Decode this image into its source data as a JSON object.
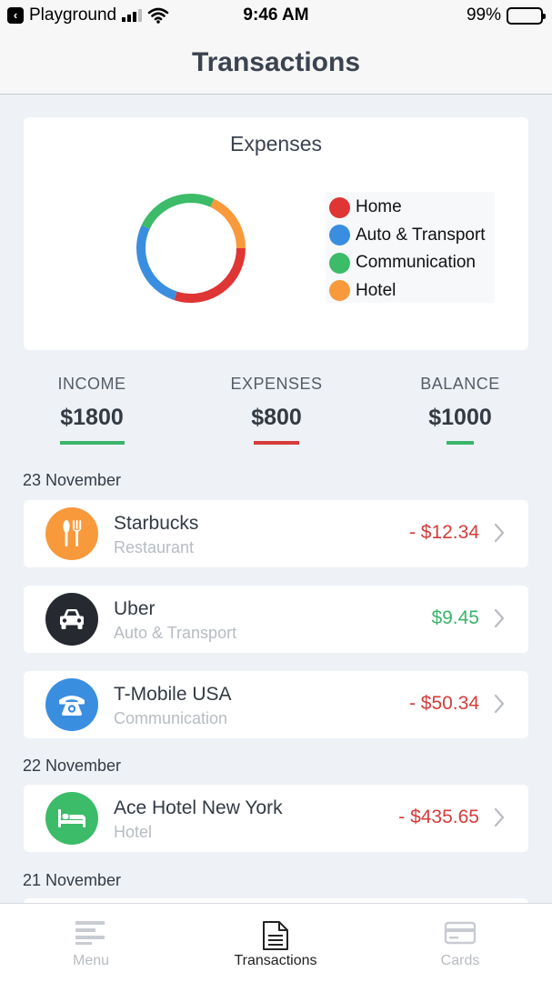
{
  "status_bar": {
    "back_app": "Playground",
    "time": "9:46 AM",
    "battery": "99%"
  },
  "nav": {
    "title": "Transactions"
  },
  "chart_card": {
    "title": "Expenses"
  },
  "chart_data": {
    "type": "pie",
    "title": "Expenses",
    "categories": [
      "Home",
      "Auto & Transport",
      "Communication",
      "Hotel"
    ],
    "values": [
      30,
      27,
      25,
      18
    ],
    "colors": [
      "#e03535",
      "#3a8ee0",
      "#3cbb68",
      "#f8993c"
    ],
    "legend_position": "right"
  },
  "summary": {
    "income": {
      "label": "INCOME",
      "value": "$1800",
      "color": "#3bb46a"
    },
    "expenses": {
      "label": "EXPENSES",
      "value": "$800",
      "color": "#d63c3c"
    },
    "balance": {
      "label": "BALANCE",
      "value": "$1000",
      "color": "#3bb46a"
    }
  },
  "sections": [
    {
      "date": "23 November",
      "transactions": [
        {
          "name": "Starbucks",
          "category": "Restaurant",
          "amount": "- $12.34",
          "icon": "restaurant-icon",
          "icon_bg": "#f8993c"
        },
        {
          "name": "Uber",
          "category": "Auto & Transport",
          "amount": "$9.45",
          "icon": "car-icon",
          "icon_bg": "#262a30"
        },
        {
          "name": "T-Mobile USA",
          "category": "Communication",
          "amount": "- $50.34",
          "icon": "phone-icon",
          "icon_bg": "#3a8ee0"
        }
      ]
    },
    {
      "date": "22 November",
      "transactions": [
        {
          "name": "Ace Hotel New York",
          "category": "Hotel",
          "amount": "- $435.65",
          "icon": "bed-icon",
          "icon_bg": "#3cbb68"
        }
      ]
    },
    {
      "date": "21 November",
      "transactions": []
    }
  ],
  "tab_bar": {
    "menu": "Menu",
    "transactions": "Transactions",
    "cards": "Cards",
    "active_color": "#222",
    "inactive_color": "#b8bcc2"
  }
}
